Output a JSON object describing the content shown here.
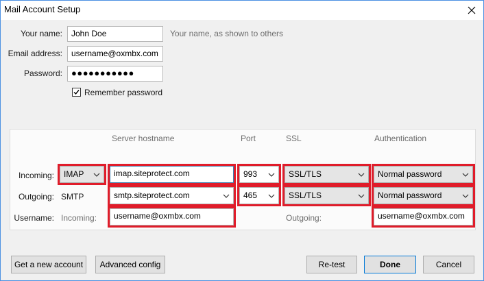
{
  "window": {
    "title": "Mail Account Setup"
  },
  "form": {
    "name_label": "Your name:",
    "name_value": "John Doe",
    "name_hint": "Your name, as shown to others",
    "email_label": "Email address:",
    "email_value": "username@oxmbx.com",
    "password_label": "Password:",
    "password_value": "●●●●●●●●●●●",
    "remember_label": "Remember password",
    "remember_checked": true
  },
  "server": {
    "headers": {
      "hostname": "Server hostname",
      "port": "Port",
      "ssl": "SSL",
      "auth": "Authentication"
    },
    "incoming": {
      "label": "Incoming:",
      "protocol": "IMAP",
      "hostname": "imap.siteprotect.com",
      "port": "993",
      "ssl": "SSL/TLS",
      "auth": "Normal password"
    },
    "outgoing": {
      "label": "Outgoing:",
      "protocol": "SMTP",
      "hostname": "smtp.siteprotect.com",
      "port": "465",
      "ssl": "SSL/TLS",
      "auth": "Normal password"
    },
    "username": {
      "label": "Username:",
      "incoming_label": "Incoming:",
      "incoming_value": "username@oxmbx.com",
      "outgoing_label": "Outgoing:",
      "outgoing_value": "username@oxmbx.com"
    }
  },
  "buttons": {
    "new_account": "Get a new account",
    "advanced": "Advanced config",
    "retest": "Re-test",
    "done": "Done",
    "cancel": "Cancel"
  },
  "colors": {
    "highlight": "#e01c2a",
    "window_border": "#4a90e2"
  }
}
